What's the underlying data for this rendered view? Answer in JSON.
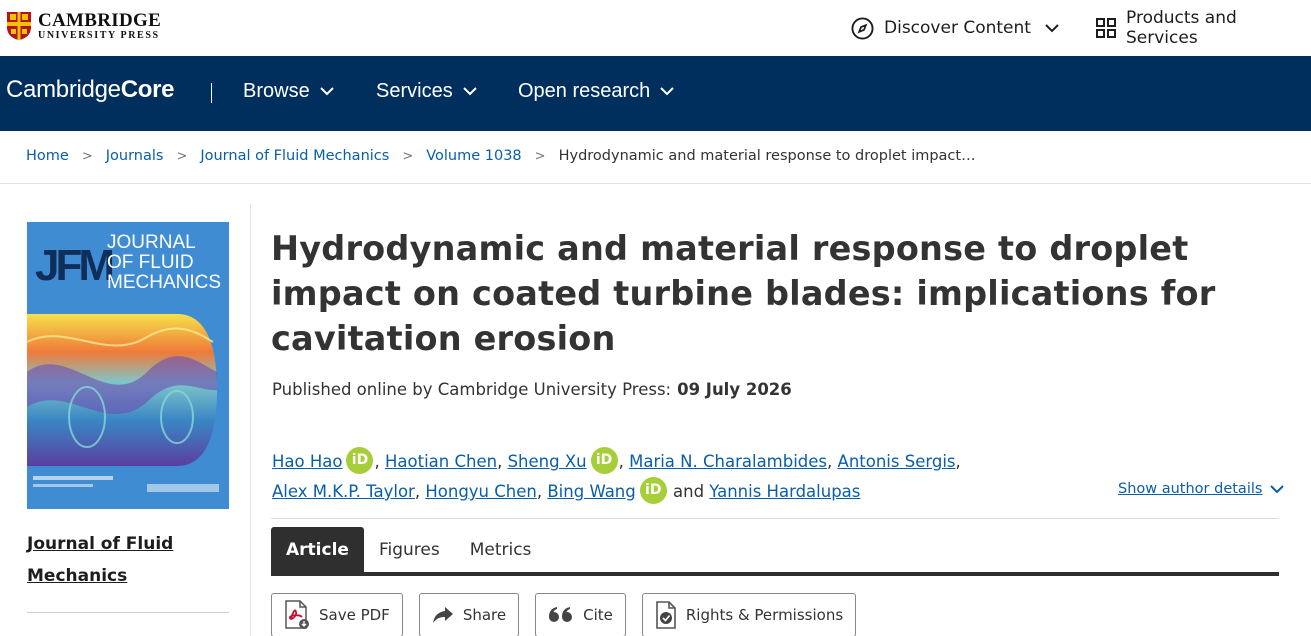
{
  "header": {
    "publisher_line1": "CAMBRIDGE",
    "publisher_line2": "UNIVERSITY PRESS",
    "discover": "Discover Content",
    "products": "Products and Services"
  },
  "nav": {
    "logo_light": "Cambridge",
    "logo_bold": "Core",
    "items": [
      {
        "label": "Browse"
      },
      {
        "label": "Services"
      },
      {
        "label": "Open research"
      }
    ]
  },
  "breadcrumb": [
    "Home",
    "Journals",
    "Journal of Fluid Mechanics",
    "Volume 1038",
    "Hydrodynamic and material response to droplet impact…"
  ],
  "cover": {
    "logo": "JFM",
    "title_line1": "JOURNAL",
    "title_line2": "OF FLUID",
    "title_line3": "MECHANICS"
  },
  "journal_link": "Journal of Fluid Mechanics",
  "article": {
    "title": "Hydrodynamic and material response to droplet impact on coated turbine blades: implications for cavitation erosion",
    "published_prefix": "Published online by Cambridge University Press:",
    "published_date": "09 July 2026",
    "authors": [
      {
        "name": "Hao Hao",
        "orcid": true
      },
      {
        "name": "Haotian Chen",
        "orcid": false
      },
      {
        "name": "Sheng Xu",
        "orcid": true
      },
      {
        "name": "Maria N. Charalambides",
        "orcid": false
      },
      {
        "name": "Antonis Sergis",
        "orcid": false
      },
      {
        "name": "Alex M.K.P. Taylor",
        "orcid": false
      },
      {
        "name": "Hongyu Chen",
        "orcid": false
      },
      {
        "name": "Bing Wang",
        "orcid": true
      },
      {
        "name": "Yannis Hardalupas",
        "orcid": false
      }
    ],
    "and_word": "and",
    "orcid_label": "iD",
    "show_details": "Show author details"
  },
  "tabs": [
    {
      "label": "Article",
      "active": true
    },
    {
      "label": "Figures",
      "active": false
    },
    {
      "label": "Metrics",
      "active": false
    }
  ],
  "actions": {
    "save_pdf": "Save PDF",
    "share": "Share",
    "cite": "Cite",
    "rights": "Rights & Permissions"
  },
  "colors": {
    "navy": "#002e5d",
    "link": "#0a5ea8",
    "orcid": "#a6ce39",
    "tab_active": "#2f2f2f"
  }
}
